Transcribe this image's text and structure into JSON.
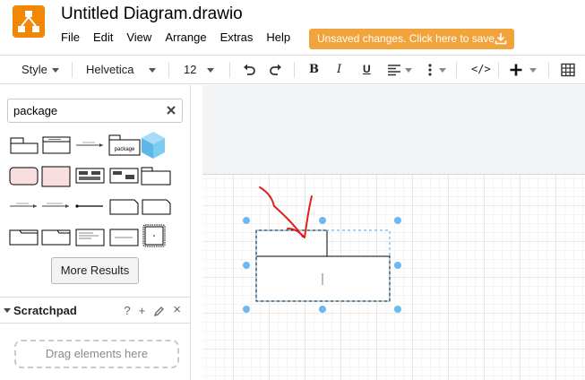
{
  "app": {
    "document_title": "Untitled Diagram.drawio",
    "menu": [
      "File",
      "Edit",
      "View",
      "Arrange",
      "Extras",
      "Help"
    ],
    "unsaved_banner": "Unsaved changes. Click here to save."
  },
  "toolbar": {
    "style_label": "Style",
    "font_name": "Helvetica",
    "font_size": "12",
    "bold": "B",
    "italic": "I",
    "underline": "U",
    "code": "</>"
  },
  "sidebar": {
    "search_value": "package",
    "more_results_label": "More Results",
    "scratchpad_title": "Scratchpad",
    "scratchpad_help": "?",
    "scratchpad_add": "+",
    "scratchpad_close": "×",
    "drop_zone_label": "Drag elements here",
    "package_shape_label": "package"
  },
  "colors": {
    "brand": "#f08705",
    "banner": "#f1a43b",
    "selection_handle": "#6db8f0",
    "annotation": "#e0201b",
    "shape_pink": "#f8dede",
    "cube_blue": "#7ecbf2"
  }
}
